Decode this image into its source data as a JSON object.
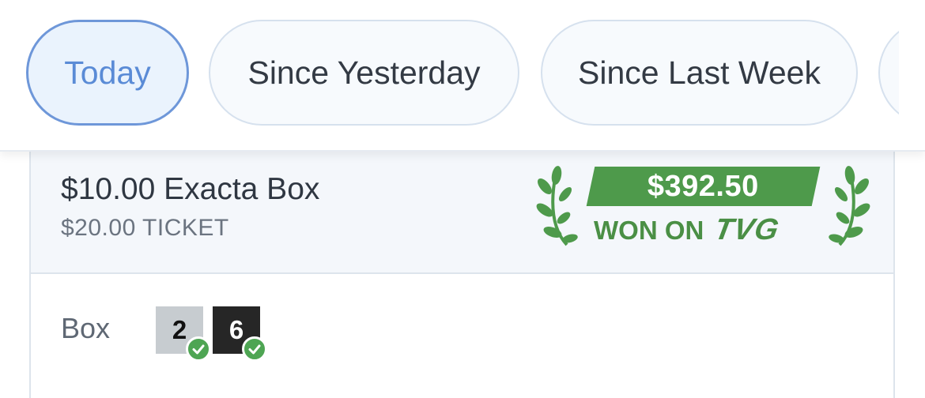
{
  "tabs": [
    {
      "label": "Today",
      "active": true
    },
    {
      "label": "Since Yesterday",
      "active": false
    },
    {
      "label": "Since Last Week",
      "active": false
    },
    {
      "label": "",
      "active": false
    }
  ],
  "bet": {
    "title": "$10.00 Exacta Box",
    "ticket": "$20.00 TICKET",
    "win_amount": "$392.50",
    "won_on_label": "WON ON",
    "brand": "TVG",
    "selection_label": "Box",
    "runners": [
      {
        "number": "2",
        "status": "check-icon"
      },
      {
        "number": "6",
        "status": "check-icon"
      }
    ]
  },
  "colors": {
    "accent_blue": "#5a8bd6",
    "win_green": "#4e9a4b",
    "check_green": "#4ea553",
    "runner_2_bg": "#c7ccd0",
    "runner_6_bg": "#262626"
  }
}
